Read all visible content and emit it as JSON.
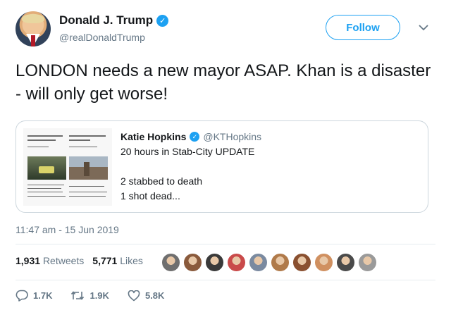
{
  "author": {
    "display_name": "Donald J. Trump",
    "handle": "@realDonaldTrump",
    "avatar_icon": "user-avatar",
    "verified_icon": "verified-badge-icon"
  },
  "follow_button": {
    "label": "Follow"
  },
  "menu_icon": "chevron-down-icon",
  "tweet": {
    "text": "LONDON needs a new mayor ASAP. Khan is a disaster - will only get worse!"
  },
  "quoted": {
    "display_name": "Katie Hopkins",
    "handle": "@KTHopkins",
    "lines": [
      "20 hours in Stab-City UPDATE",
      "2 stabbed to death",
      "1 shot dead..."
    ]
  },
  "timestamp": "11:47 am - 15 Jun 2019",
  "stats": {
    "retweets_count": "1,931",
    "retweets_label": "Retweets",
    "likes_count": "5,771",
    "likes_label": "Likes"
  },
  "liker_avatars": [
    "#6f6f6f",
    "#8a5a3c",
    "#3a3a3a",
    "#c94a4a",
    "#7a8aa0",
    "#b07a4a",
    "#8a5030",
    "#d09060",
    "#4a4a4a",
    "#9a9a9a"
  ],
  "actions": {
    "reply_count": "1.7K",
    "retweet_count": "1.9K",
    "like_count": "5.8K"
  },
  "colors": {
    "accent": "#1da1f2",
    "muted": "#657786",
    "text": "#14171a",
    "border": "#ccd6dd"
  }
}
